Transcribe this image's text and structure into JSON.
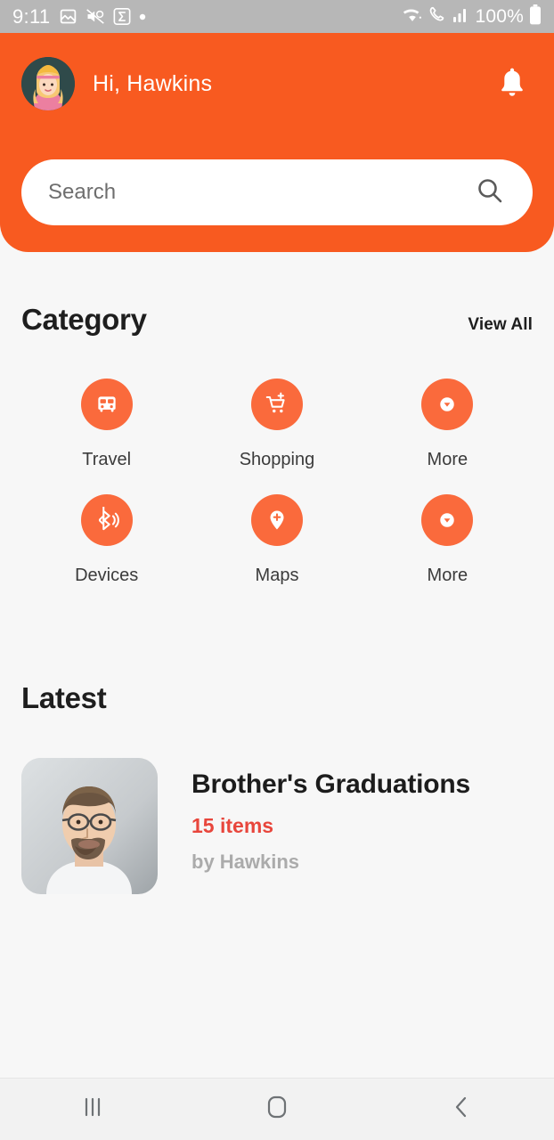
{
  "status_bar": {
    "time": "9:11",
    "battery_text": "100%",
    "left_icons": [
      "image-icon",
      "no-sound-icon",
      "sigma-icon",
      "dot-icon"
    ],
    "right_icons": [
      "wifi-icon",
      "call-icon",
      "signal-icon",
      "battery-icon"
    ]
  },
  "header": {
    "greeting": "Hi, Hawkins",
    "avatar_icon": "user-avatar",
    "notification_icon": "bell-icon",
    "background_color": "#F85A20"
  },
  "search": {
    "value": "",
    "placeholder": "Search",
    "icon": "search-icon"
  },
  "category_section": {
    "title": "Category",
    "view_all_label": "View All",
    "items": [
      {
        "label": "Travel",
        "icon": "bus-icon"
      },
      {
        "label": "Shopping",
        "icon": "cart-plus-icon"
      },
      {
        "label": "More",
        "icon": "chevron-down-circle-icon"
      },
      {
        "label": "Devices",
        "icon": "bluetooth-audio-icon"
      },
      {
        "label": "Maps",
        "icon": "map-pin-plus-icon"
      },
      {
        "label": "More",
        "icon": "chevron-down-circle-icon"
      }
    ],
    "icon_circle_color": "#FA6A3C"
  },
  "latest_section": {
    "title": "Latest",
    "items": [
      {
        "title": "Brother's Graduations",
        "count": "15 items",
        "author": "by Hawkins",
        "thumbnail": "portrait-photo",
        "count_color": "#E8463C"
      }
    ]
  },
  "nav_bar": {
    "recents_label": "recents-icon",
    "home_label": "home-icon",
    "back_label": "back-icon"
  }
}
